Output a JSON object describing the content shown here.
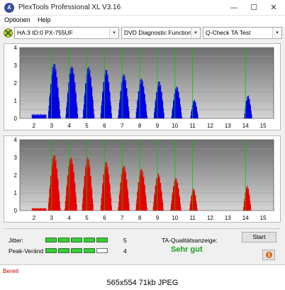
{
  "window": {
    "title": "PlexTools Professional XL V3.16",
    "icon_letter": "ʎ",
    "minimize": "—",
    "maximize": "☐",
    "close": "✕"
  },
  "menu": {
    "items": [
      "Optionen",
      "Help"
    ]
  },
  "toolbar": {
    "drive": "HA:3 ID:0  PX-755UF",
    "function": "DVD Diagnostic Functions",
    "test": "Q-Check TA Test",
    "dropdown_glyph": "▾"
  },
  "chart_data": [
    {
      "type": "bar",
      "name": "",
      "color": "#0000e6",
      "x_ticks": [
        "2",
        "3",
        "4",
        "5",
        "6",
        "7",
        "8",
        "9",
        "10",
        "11",
        "12",
        "13",
        "14",
        "15"
      ],
      "y_ticks": [
        "0",
        "0.5",
        "1",
        "1.5",
        "2",
        "2.5",
        "3",
        "3.5",
        "4"
      ],
      "xlim": [
        1.2,
        15.6
      ],
      "ylim": [
        0,
        4
      ],
      "marker_lines": [
        3,
        4,
        5,
        6,
        7,
        8,
        9,
        10,
        11,
        14
      ],
      "marker_color": "#00c800",
      "peaks": [
        {
          "center": 3.15,
          "height": 3.1,
          "width": 0.7
        },
        {
          "center": 4.15,
          "height": 2.95,
          "width": 0.7
        },
        {
          "center": 5.1,
          "height": 2.9,
          "width": 0.65
        },
        {
          "center": 6.1,
          "height": 2.75,
          "width": 0.65
        },
        {
          "center": 7.1,
          "height": 2.5,
          "width": 0.65
        },
        {
          "center": 8.1,
          "height": 2.25,
          "width": 0.65
        },
        {
          "center": 9.1,
          "height": 2.1,
          "width": 0.6
        },
        {
          "center": 10.1,
          "height": 1.8,
          "width": 0.6
        },
        {
          "center": 11.1,
          "height": 1.05,
          "width": 0.45
        },
        {
          "center": 14.15,
          "height": 1.3,
          "width": 0.45
        }
      ],
      "baseline_noise": [
        {
          "from": 1.9,
          "to": 2.7,
          "height": 0.25
        }
      ]
    },
    {
      "type": "bar",
      "name": "",
      "color": "#e60000",
      "x_ticks": [
        "2",
        "3",
        "4",
        "5",
        "6",
        "7",
        "8",
        "9",
        "10",
        "11",
        "12",
        "13",
        "14",
        "15"
      ],
      "y_ticks": [
        "0",
        "0.5",
        "1",
        "1.5",
        "2",
        "2.5",
        "3",
        "3.5",
        "4"
      ],
      "xlim": [
        1.2,
        15.6
      ],
      "ylim": [
        0,
        4
      ],
      "marker_lines": [
        3,
        4,
        5,
        6,
        7,
        8,
        9,
        10,
        11,
        14
      ],
      "marker_color": "#00c800",
      "peaks": [
        {
          "center": 3.15,
          "height": 3.15,
          "width": 0.7
        },
        {
          "center": 4.1,
          "height": 3.0,
          "width": 0.7
        },
        {
          "center": 5.05,
          "height": 3.0,
          "width": 0.65
        },
        {
          "center": 6.1,
          "height": 2.75,
          "width": 0.65
        },
        {
          "center": 7.1,
          "height": 2.55,
          "width": 0.65
        },
        {
          "center": 8.1,
          "height": 2.35,
          "width": 0.65
        },
        {
          "center": 9.05,
          "height": 2.1,
          "width": 0.6
        },
        {
          "center": 10.05,
          "height": 1.85,
          "width": 0.6
        },
        {
          "center": 11.05,
          "height": 1.25,
          "width": 0.45
        },
        {
          "center": 14.1,
          "height": 1.4,
          "width": 0.45
        }
      ],
      "baseline_noise": [
        {
          "from": 1.9,
          "to": 2.7,
          "height": 0.15
        }
      ]
    }
  ],
  "results": {
    "jitter_label": "Jitter:",
    "jitter_value": "5",
    "jitter_level": 5,
    "peak_label": "Peak-Veränd",
    "peak_value": "4",
    "peak_level": 4,
    "meter_max": 5,
    "quality_label": "TA-Qualitätsanzeige:",
    "quality_value": "Sehr gut",
    "start_button": "Start",
    "info_glyph": "i"
  },
  "status": {
    "text": "Bereit"
  },
  "caption": "565x554 71kb JPEG"
}
